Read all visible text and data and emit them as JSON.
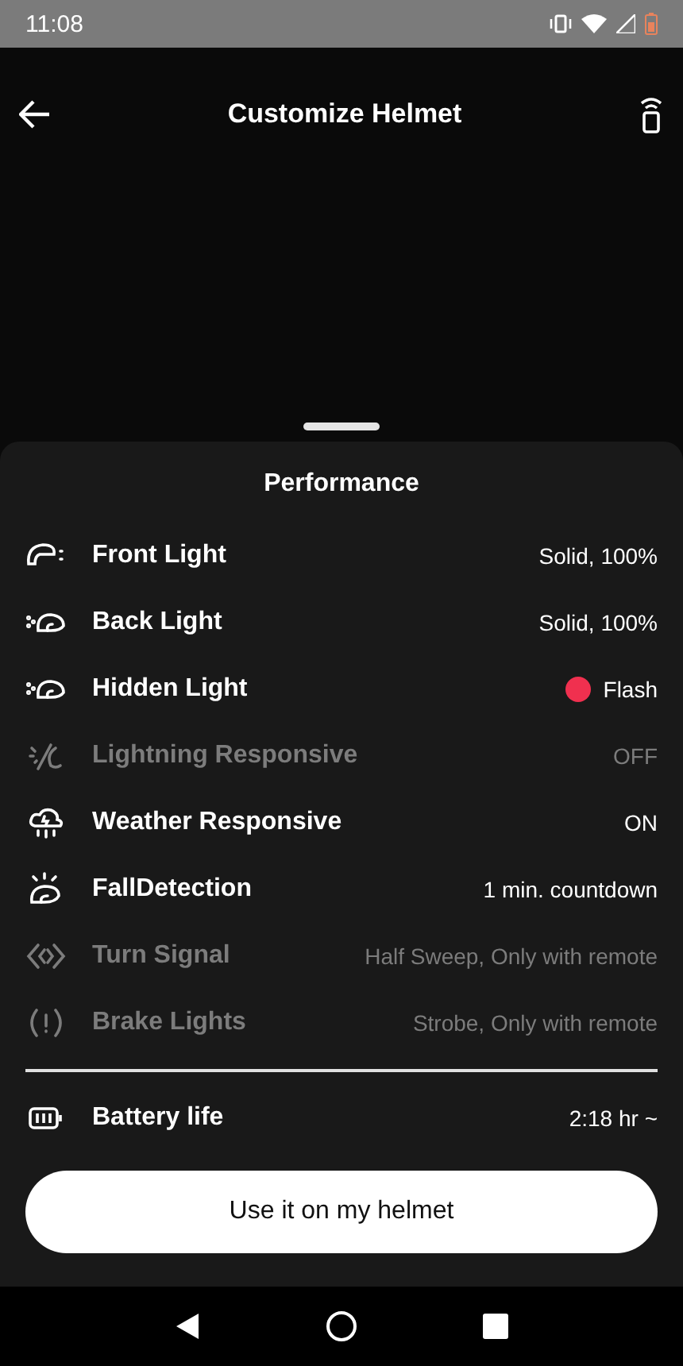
{
  "status_bar": {
    "time": "11:08"
  },
  "header": {
    "title": "Customize Helmet"
  },
  "sheet": {
    "title": "Performance",
    "settings": [
      {
        "kind": "front",
        "label": "Front Light",
        "value": "Solid, 100%",
        "disabled": false
      },
      {
        "kind": "back",
        "label": "Back Light",
        "value": "Solid, 100%",
        "disabled": false
      },
      {
        "kind": "back",
        "label": "Hidden Light",
        "value": "Flash",
        "disabled": false,
        "color": "#f0304f"
      },
      {
        "kind": "lightning",
        "label": "Lightning Responsive",
        "value": "OFF",
        "disabled": true
      },
      {
        "kind": "weather",
        "label": "Weather Responsive",
        "value": "ON",
        "disabled": false
      },
      {
        "kind": "fall",
        "label": "FallDetection",
        "value": "1 min. countdown",
        "disabled": false
      },
      {
        "kind": "turn",
        "label": "Turn Signal",
        "value": "Half Sweep, Only with remote",
        "disabled": true
      },
      {
        "kind": "brake",
        "label": "Brake Lights",
        "value": "Strobe, Only with remote",
        "disabled": true
      }
    ],
    "battery": {
      "label": "Battery life",
      "value": "2:18 hr ~"
    },
    "button": "Use it on my helmet"
  }
}
